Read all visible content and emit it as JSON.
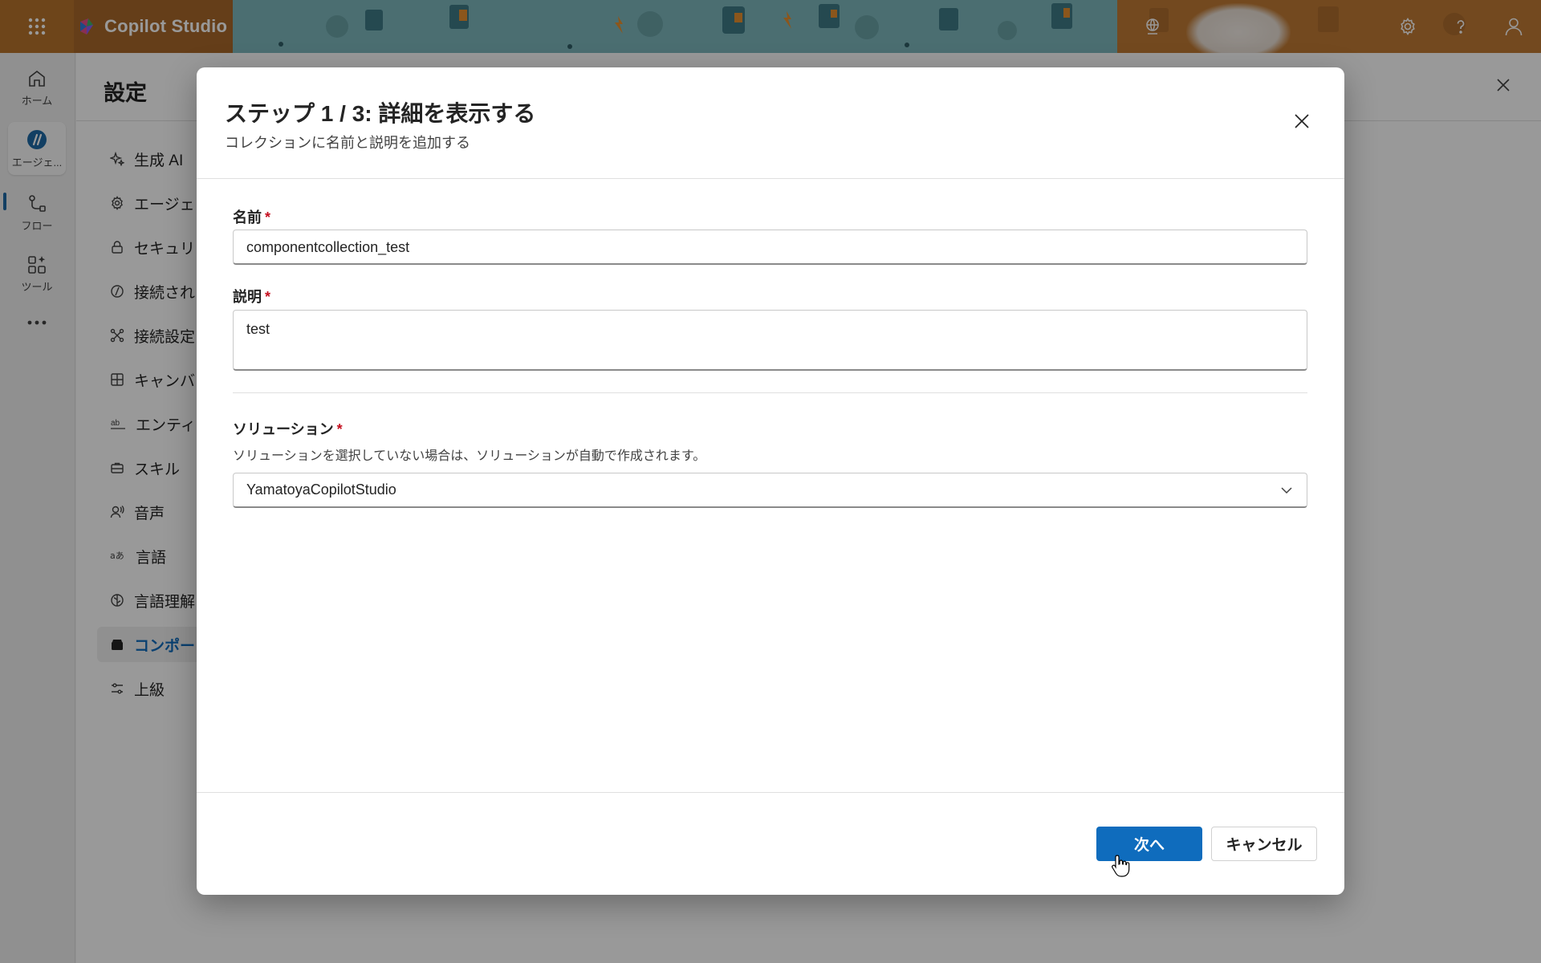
{
  "app": {
    "title": "Copilot Studio"
  },
  "topbar": {
    "icons": [
      "waffle-icon",
      "environment-icon",
      "settings-icon",
      "help-icon",
      "account-icon"
    ]
  },
  "rail": {
    "items": [
      {
        "label": "ホーム",
        "icon": "home-icon"
      },
      {
        "label": "エージェ...",
        "icon": "agent-icon"
      },
      {
        "label": "フロー",
        "icon": "flow-icon"
      },
      {
        "label": "ツール",
        "icon": "tools-icon"
      }
    ],
    "more_icon": "more-icon"
  },
  "settings": {
    "title": "設定",
    "nav": [
      {
        "label": "生成 AI",
        "icon": "sparkle-icon"
      },
      {
        "label": "エージェ",
        "icon": "gear-icon"
      },
      {
        "label": "セキュリ",
        "icon": "lock-icon"
      },
      {
        "label": "接続され",
        "icon": "plugin-icon"
      },
      {
        "label": "接続設定",
        "icon": "connector-icon"
      },
      {
        "label": "キャンバ",
        "icon": "grid-icon"
      },
      {
        "label": "エンティ",
        "icon": "entity-icon"
      },
      {
        "label": "スキル",
        "icon": "briefcase-icon"
      },
      {
        "label": "音声",
        "icon": "voice-icon"
      },
      {
        "label": "言語",
        "icon": "language-icon"
      },
      {
        "label": "言語理解",
        "icon": "brain-icon"
      },
      {
        "label": "コンポー",
        "icon": "component-icon",
        "active": true
      },
      {
        "label": "上級",
        "icon": "options-icon"
      }
    ]
  },
  "dialog": {
    "title": "ステップ 1 / 3: 詳細を表示する",
    "subtitle": "コレクションに名前と説明を追加する",
    "name": {
      "label": "名前",
      "required": "*",
      "value": "componentcollection_test"
    },
    "description": {
      "label": "説明",
      "required": "*",
      "value": "test"
    },
    "solution": {
      "label": "ソリューション",
      "required": "*",
      "hint": "ソリューションを選択していない場合は、ソリューションが自動で作成されます。",
      "selected": "YamatoyaCopilotStudio"
    },
    "buttons": {
      "next": "次へ",
      "cancel": "キャンセル"
    }
  },
  "colors": {
    "primary": "#0f6cbd",
    "topbar": "#b8742c",
    "required": "#c50f1f"
  }
}
